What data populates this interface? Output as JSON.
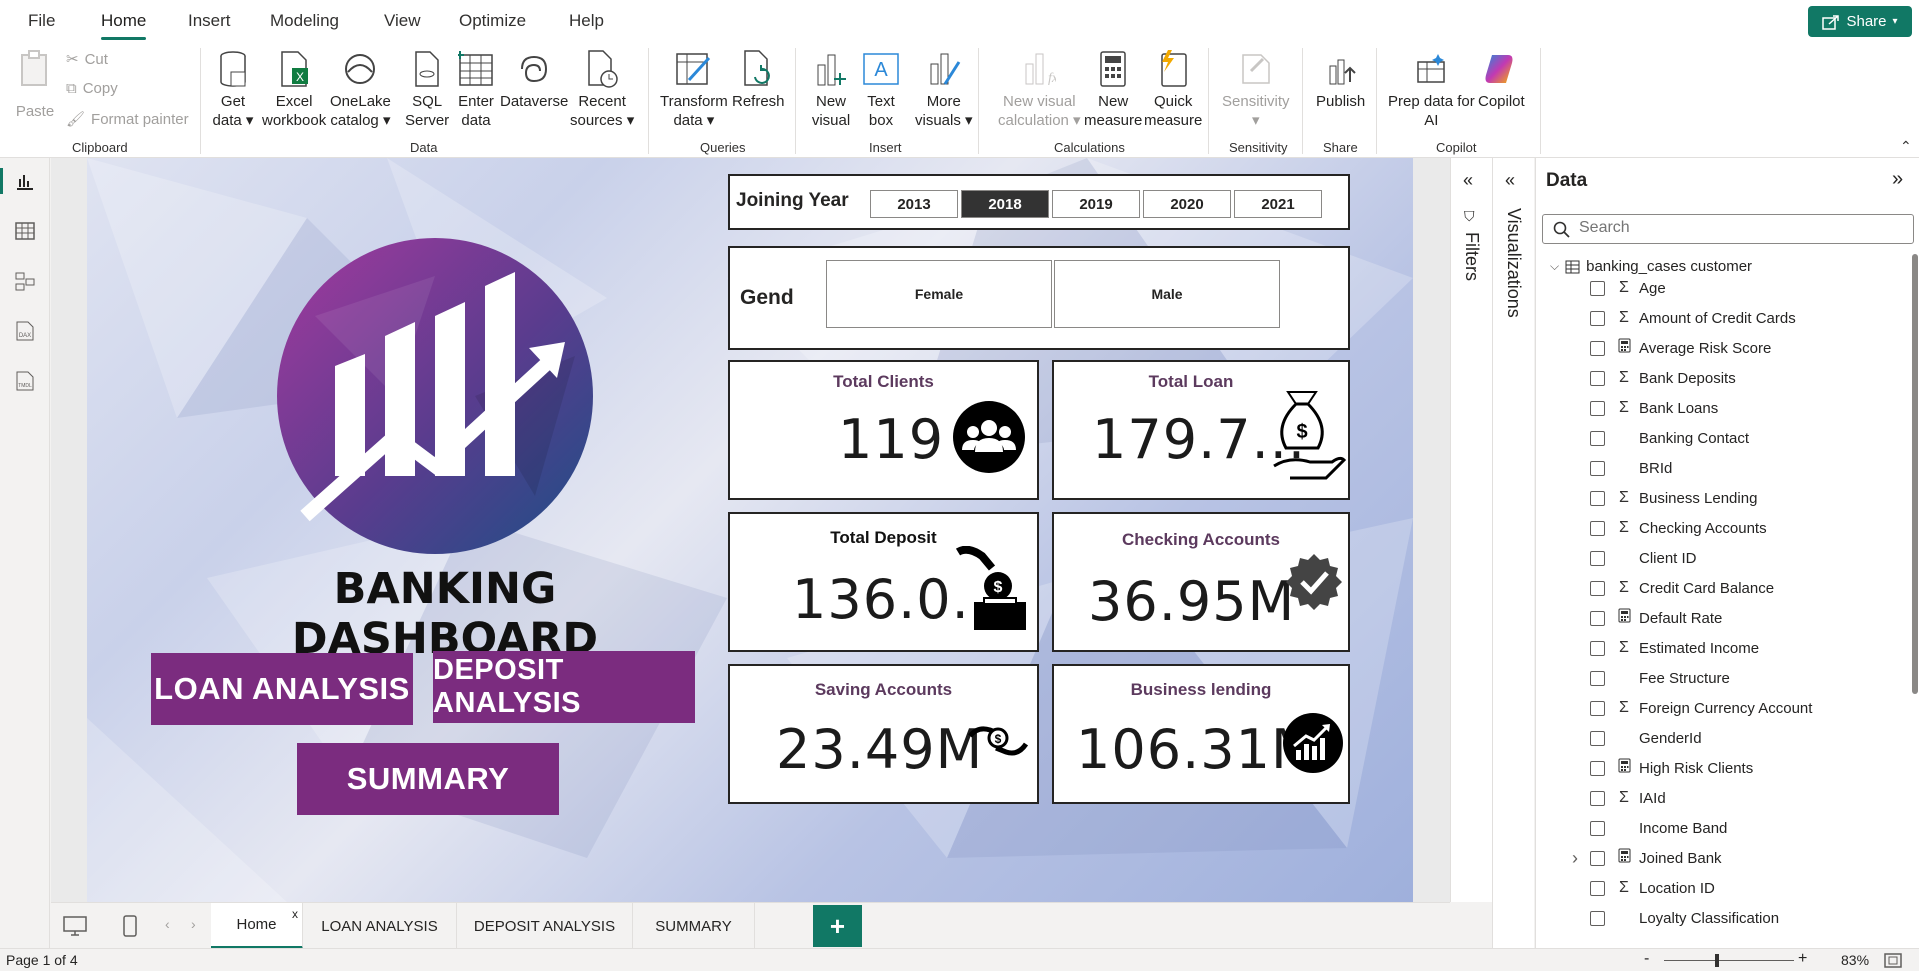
{
  "menu": {
    "tabs": [
      "File",
      "Home",
      "Insert",
      "Modeling",
      "View",
      "Optimize",
      "Help"
    ],
    "active": "Home",
    "share_label": "Share"
  },
  "ribbon": {
    "clipboard": {
      "paste": "Paste",
      "cut": "Cut",
      "copy": "Copy",
      "format_painter": "Format painter",
      "group": "Clipboard"
    },
    "data": {
      "get_data_1": "Get",
      "get_data_2": "data",
      "excel_1": "Excel",
      "excel_2": "workbook",
      "onelake_1": "OneLake",
      "onelake_2": "catalog",
      "sql_1": "SQL",
      "sql_2": "Server",
      "enter_1": "Enter",
      "enter_2": "data",
      "dataverse": "Dataverse",
      "recent_1": "Recent",
      "recent_2": "sources",
      "group": "Data"
    },
    "queries": {
      "transform_1": "Transform",
      "transform_2": "data",
      "refresh": "Refresh",
      "group": "Queries"
    },
    "insert": {
      "new_visual_1": "New",
      "new_visual_2": "visual",
      "text_box_1": "Text",
      "text_box_2": "box",
      "more_visuals_1": "More",
      "more_visuals_2": "visuals",
      "group": "Insert"
    },
    "calculations": {
      "new_visual_calc_1": "New visual",
      "new_visual_calc_2": "calculation",
      "new_measure_1": "New",
      "new_measure_2": "measure",
      "quick_measure_1": "Quick",
      "quick_measure_2": "measure",
      "group": "Calculations"
    },
    "sensitivity": {
      "label": "Sensitivity",
      "group": "Sensitivity"
    },
    "share": {
      "publish": "Publish",
      "group": "Share"
    },
    "copilot": {
      "prep_1": "Prep data for",
      "prep_2": "AI",
      "copilot": "Copilot",
      "group": "Copilot"
    }
  },
  "report": {
    "title": "BANKING DASHBOARD",
    "buttons": {
      "loan": "LOAN ANALYSIS",
      "deposit": "DEPOSIT ANALYSIS",
      "summary": "SUMMARY"
    },
    "year_slicer": {
      "label": "Joining Year",
      "years": [
        "2013",
        "2018",
        "2019",
        "2020",
        "2021"
      ],
      "selected": "2018"
    },
    "gender_slicer": {
      "label": "Gend",
      "options": [
        "Female",
        "Male"
      ]
    },
    "cards": {
      "total_clients": {
        "title": "Total Clients",
        "value": "119"
      },
      "total_loan": {
        "title": "Total Loan",
        "value": "179.7..."
      },
      "total_deposit": {
        "title": "Total Deposit",
        "value": "136.0..."
      },
      "checking_accounts": {
        "title": "Checking Accounts",
        "value": "36.95M"
      },
      "saving_accounts": {
        "title": "Saving Accounts",
        "value": "23.49M"
      },
      "business_lending": {
        "title": "Business lending",
        "value": "106.31M"
      }
    },
    "colors": {
      "accent": "#7b2c7f",
      "brand": "#117865"
    }
  },
  "panes": {
    "filters": "Filters",
    "visualizations": "Visualizations",
    "data": {
      "title": "Data",
      "search_placeholder": "Search",
      "table": "banking_cases customer",
      "fields": [
        {
          "name": "Age",
          "type": "sigma"
        },
        {
          "name": "Amount of Credit Cards",
          "type": "sigma"
        },
        {
          "name": "Average Risk Score",
          "type": "calc"
        },
        {
          "name": "Bank Deposits",
          "type": "sigma"
        },
        {
          "name": "Bank Loans",
          "type": "sigma"
        },
        {
          "name": "Banking Contact",
          "type": "none"
        },
        {
          "name": "BRId",
          "type": "none"
        },
        {
          "name": "Business Lending",
          "type": "sigma"
        },
        {
          "name": "Checking Accounts",
          "type": "sigma"
        },
        {
          "name": "Client ID",
          "type": "none"
        },
        {
          "name": "Credit Card Balance",
          "type": "sigma"
        },
        {
          "name": "Default Rate",
          "type": "calc"
        },
        {
          "name": "Estimated Income",
          "type": "sigma"
        },
        {
          "name": "Fee Structure",
          "type": "none"
        },
        {
          "name": "Foreign Currency Account",
          "type": "sigma"
        },
        {
          "name": "GenderId",
          "type": "none"
        },
        {
          "name": "High Risk Clients",
          "type": "calc"
        },
        {
          "name": "IAId",
          "type": "sigma"
        },
        {
          "name": "Income Band",
          "type": "none"
        },
        {
          "name": "Joined Bank",
          "type": "calc",
          "expandable": true
        },
        {
          "name": "Location ID",
          "type": "sigma"
        },
        {
          "name": "Loyalty Classification",
          "type": "none"
        }
      ]
    }
  },
  "page_tabs": {
    "tabs": [
      "Home",
      "LOAN ANALYSIS",
      "DEPOSIT ANALYSIS",
      "SUMMARY"
    ],
    "active": "Home",
    "close": "x",
    "add": "+"
  },
  "status": {
    "page": "Page 1 of 4",
    "zoom": "83%",
    "zoom_minus": "-",
    "zoom_plus": "+"
  }
}
